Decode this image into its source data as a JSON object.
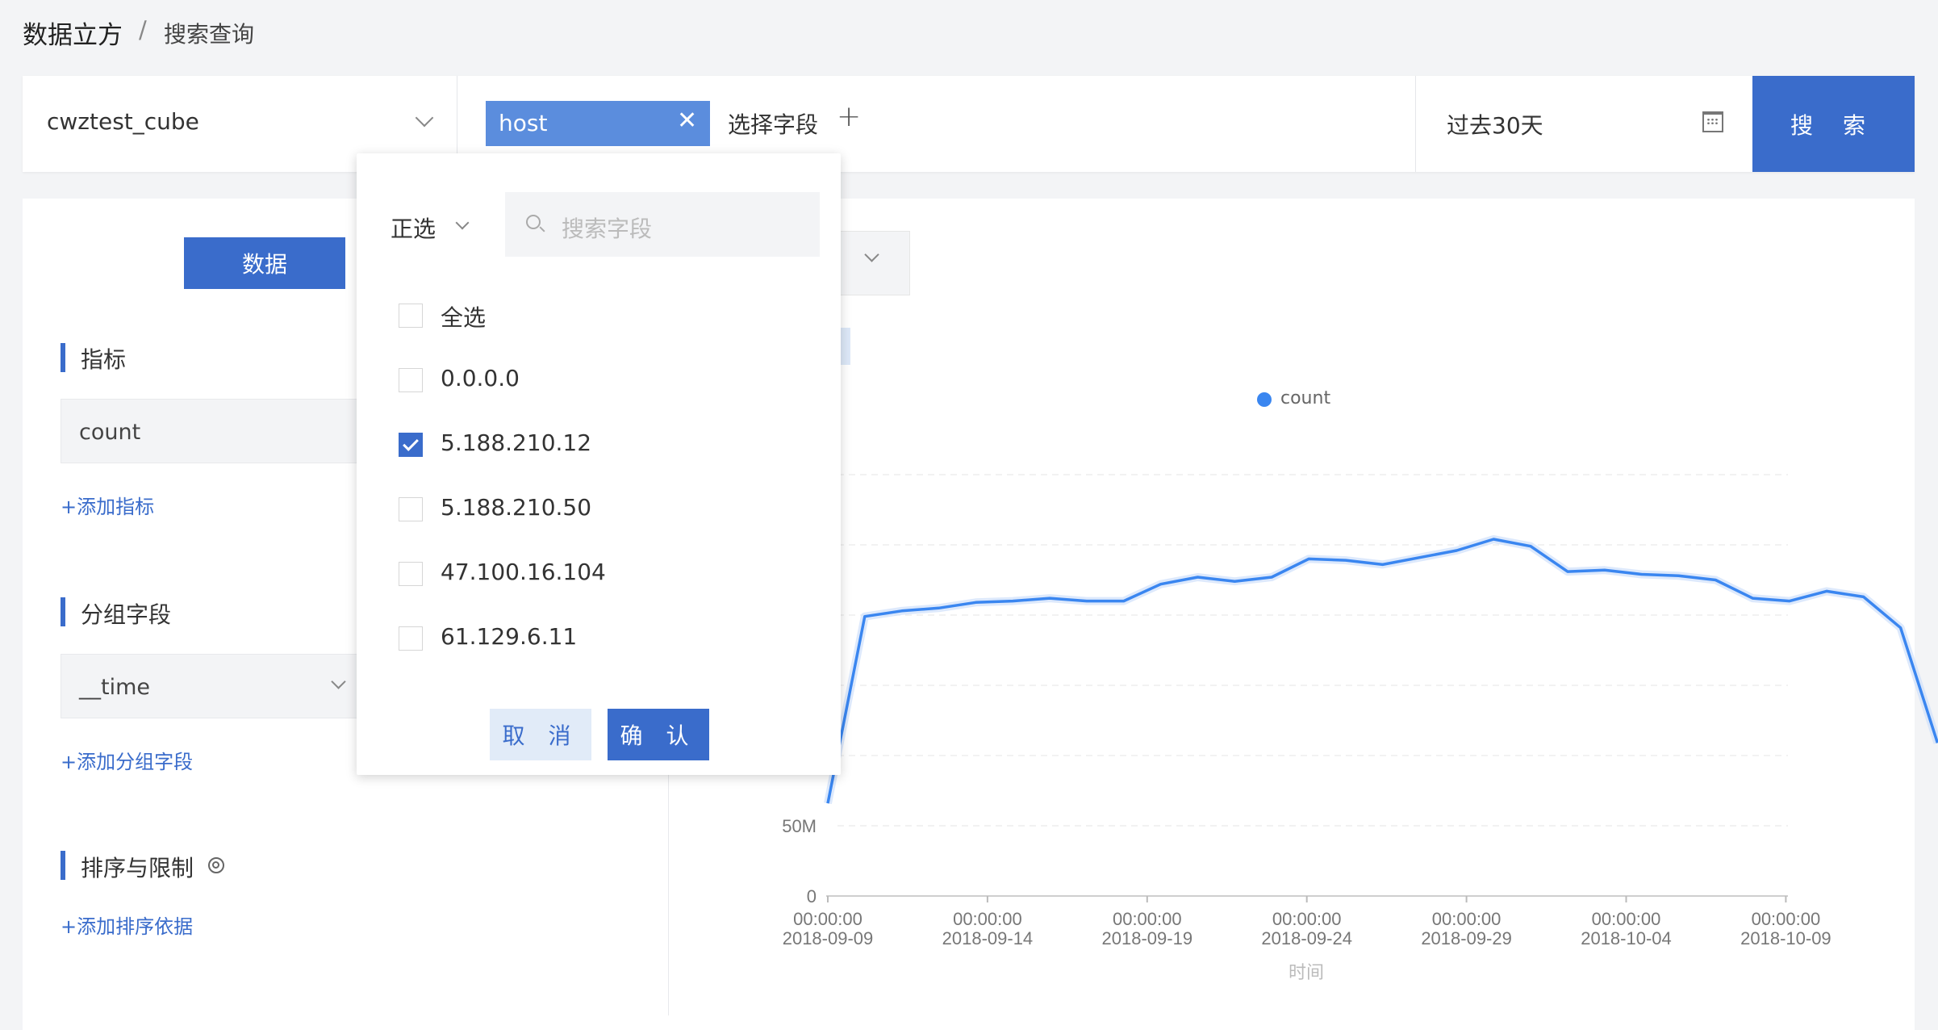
{
  "breadcrumb": {
    "root": "数据立方",
    "separator": "/",
    "current": "搜索查询"
  },
  "toolbar": {
    "cube": "cwztest_cube",
    "filter_tag": "host",
    "pick_field": "选择字段",
    "time_range": "过去30天",
    "search_label": "搜 索"
  },
  "left": {
    "data_tab": "数据",
    "metrics_title": "指标",
    "metric_value": "count",
    "add_metric": "+添加指标",
    "group_title": "分组字段",
    "group_value": "__time",
    "add_group": "+添加分组字段",
    "sort_title": "排序与限制",
    "add_sort": "+添加排序依据"
  },
  "popover": {
    "mode": "正选",
    "search_placeholder": "搜索字段",
    "options": [
      {
        "label": "全选",
        "checked": false
      },
      {
        "label": "0.0.0.0",
        "checked": false
      },
      {
        "label": "5.188.210.12",
        "checked": true
      },
      {
        "label": "5.188.210.50",
        "checked": false
      },
      {
        "label": "47.100.16.104",
        "checked": false
      },
      {
        "label": "61.129.6.11",
        "checked": false
      }
    ],
    "cancel": "取 消",
    "confirm": "确 认"
  },
  "chart_data": {
    "type": "line",
    "title": "",
    "xlabel": "时间",
    "ylabel": "",
    "legend": "count",
    "legend_position": "top-center",
    "grid": true,
    "y_tick_labels": [
      "0",
      "50M"
    ],
    "x_tick_labels": [
      [
        "00:00:00",
        "2018-09-09"
      ],
      [
        "00:00:00",
        "2018-09-14"
      ],
      [
        "00:00:00",
        "2018-09-19"
      ],
      [
        "00:00:00",
        "2018-09-24"
      ],
      [
        "00:00:00",
        "2018-09-29"
      ],
      [
        "00:00:00",
        "2018-10-04"
      ],
      [
        "00:00:00",
        "2018-10-09"
      ]
    ],
    "series": [
      {
        "name": "count",
        "color": "#3a86f0",
        "x": [
          "2018-09-09",
          "2018-09-10",
          "2018-09-11",
          "2018-09-12",
          "2018-09-13",
          "2018-09-14",
          "2018-09-15",
          "2018-09-16",
          "2018-09-17",
          "2018-09-18",
          "2018-09-19",
          "2018-09-20",
          "2018-09-21",
          "2018-09-22",
          "2018-09-23",
          "2018-09-24",
          "2018-09-25",
          "2018-09-26",
          "2018-09-27",
          "2018-09-28",
          "2018-09-29",
          "2018-09-30",
          "2018-10-01",
          "2018-10-02",
          "2018-10-03",
          "2018-10-04",
          "2018-10-05",
          "2018-10-06",
          "2018-10-07",
          "2018-10-08",
          "2018-10-09"
        ],
        "values": [
          66,
          199,
          203,
          205,
          209,
          210,
          212,
          210,
          210,
          222,
          227,
          224,
          227,
          240,
          239,
          236,
          241,
          246,
          254,
          249,
          231,
          232,
          229,
          228,
          225,
          212,
          210,
          217,
          213,
          191,
          109
        ]
      }
    ]
  }
}
